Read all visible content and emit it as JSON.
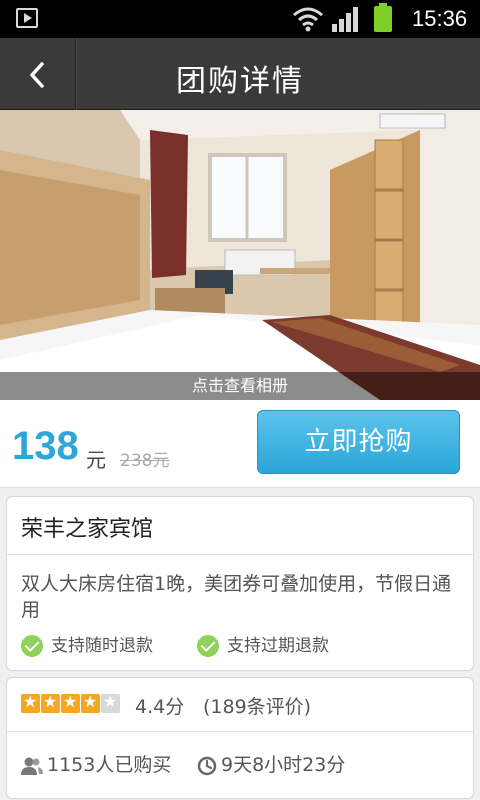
{
  "status_bar": {
    "time": "15:36"
  },
  "header": {
    "title": "团购详情"
  },
  "hero": {
    "caption": "点击查看相册"
  },
  "deal": {
    "price": "138",
    "price_unit": "元",
    "original_price": "238元",
    "buy_label": "立即抢购"
  },
  "hotel": {
    "name": "荣丰之家宾馆",
    "description": "双人大床房住宿1晚，美团券可叠加使用，节假日通用",
    "features": [
      "支持随时退款",
      "支持过期退款"
    ]
  },
  "stats": {
    "stars_filled": 4,
    "stars_total": 5,
    "rating": "4.4分",
    "reviews": "(189条评价)",
    "bought": "1153人已购买",
    "time_left": "9天8小时23分"
  },
  "colors": {
    "accent": "#2ea6d7",
    "star": "#f5a623",
    "check": "#8fd15a"
  }
}
